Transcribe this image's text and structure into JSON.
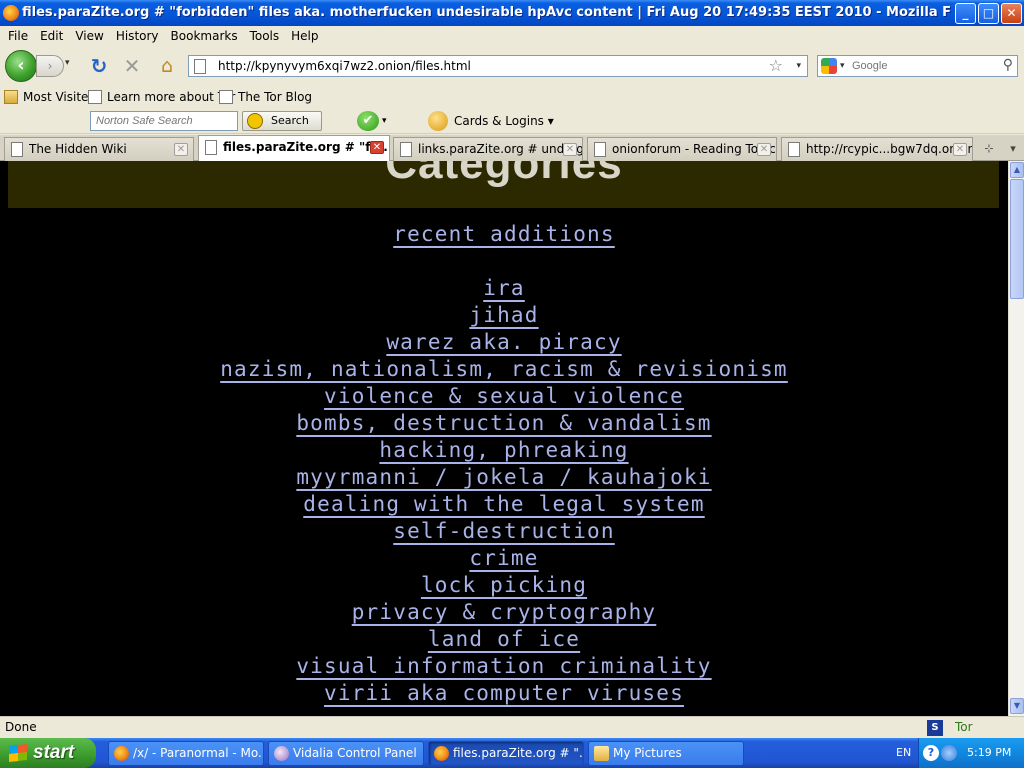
{
  "window": {
    "title": "files.paraZite.org # \"forbidden\" files aka. motherfucken undesirable hpAvc content | Fri Aug 20 17:49:35 EEST 2010 - Mozilla Firefox",
    "minimize": "_",
    "maximize": "□",
    "close": "✕"
  },
  "menu": [
    "File",
    "Edit",
    "View",
    "History",
    "Bookmarks",
    "Tools",
    "Help"
  ],
  "nav": {
    "back_icon": "‹",
    "forward_icon": "›",
    "reload_icon": "↻",
    "stop_icon": "✕",
    "home_icon": "⌂",
    "url": "http://kpynyvym6xqi7wz2.onion/files.html",
    "star_icon": "☆",
    "dropdown_icon": "▾",
    "search_placeholder": "Google",
    "search_icon": "⚲"
  },
  "bookmarks": [
    "Most Visited",
    "Learn more about Tor",
    "The Tor Blog"
  ],
  "norton": {
    "search_placeholder": "Norton Safe Search",
    "search_button": "Search",
    "safe_icon": "✔",
    "cards_label": "Cards & Logins",
    "dropdown_icon": "▾"
  },
  "tabs": [
    {
      "label": "The Hidden Wiki",
      "active": false
    },
    {
      "label": "files.paraZite.org # \"fo...",
      "active": true
    },
    {
      "label": "links.paraZite.org # underg...",
      "active": false
    },
    {
      "label": "onionforum - Reading Topic...",
      "active": false
    },
    {
      "label": "http://rcypic...bgw7dq.onion/",
      "active": false
    }
  ],
  "tab_close": "✕",
  "tab_list_icon": "⊹",
  "tab_menu_icon": "▾",
  "page": {
    "heading": "Categories",
    "recent": "recent additions",
    "categories": [
      "ira",
      "jihad",
      "warez aka. piracy",
      "nazism, nationalism, racism & revisionism",
      "violence & sexual violence",
      "bombs, destruction & vandalism",
      "hacking, phreaking",
      "myyrmanni / jokela / kauhajoki",
      "dealing with the legal system",
      "self-destruction",
      "crime",
      "lock picking",
      "privacy & cryptography",
      "land of ice",
      "visual information criminality",
      "virii aka computer viruses"
    ]
  },
  "scroll": {
    "up": "▲",
    "down": "▼"
  },
  "status": {
    "text": "Done",
    "s_icon": "S",
    "tor": "Tor Enabled"
  },
  "taskbar": {
    "start": "start",
    "items": [
      {
        "label": "/x/ - Paranormal - Mo...",
        "icon": "ff"
      },
      {
        "label": "Vidalia Control Panel",
        "icon": "onion"
      },
      {
        "label": "files.paraZite.org # \"...",
        "icon": "ff"
      },
      {
        "label": "My Pictures",
        "icon": "folder"
      }
    ],
    "lang": "EN",
    "help_icon": "?",
    "clock": "5:19 PM"
  }
}
